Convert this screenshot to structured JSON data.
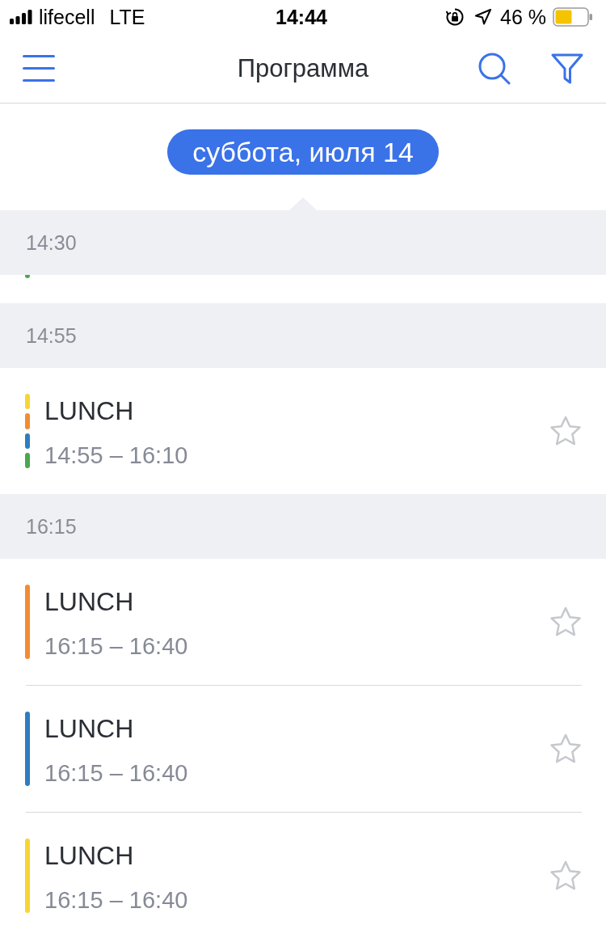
{
  "status_bar": {
    "carrier": "lifecell",
    "network": "LTE",
    "time": "14:44",
    "battery": "46 %"
  },
  "nav_bar": {
    "title": "Программа"
  },
  "date_selector": {
    "label": "суббота, июля 14"
  },
  "sections": [
    {
      "time": "14:30",
      "events": [
        {
          "kind": "clipped",
          "tracks": [
            {
              "color": "#4aa84e"
            }
          ]
        }
      ]
    },
    {
      "time": "14:55",
      "events": [
        {
          "kind": "full",
          "title": "LUNCH",
          "time_range": "14:55 – 16:10",
          "starred": false,
          "tracks": [
            {
              "color": "#f7d534"
            },
            {
              "color": "#f28c33"
            },
            {
              "color": "#2f7dc0"
            },
            {
              "color": "#4aa84e"
            }
          ]
        }
      ]
    },
    {
      "time": "16:15",
      "events": [
        {
          "kind": "full",
          "title": "LUNCH",
          "time_range": "16:15 – 16:40",
          "starred": false,
          "tracks": [
            {
              "color": "#f28c33"
            }
          ]
        },
        {
          "kind": "full",
          "title": "LUNCH",
          "time_range": "16:15 – 16:40",
          "starred": false,
          "tracks": [
            {
              "color": "#2f7dc0"
            }
          ]
        },
        {
          "kind": "full",
          "title": "LUNCH",
          "time_range": "16:15 – 16:40",
          "starred": false,
          "tracks": [
            {
              "color": "#f7d534"
            }
          ]
        }
      ]
    }
  ]
}
